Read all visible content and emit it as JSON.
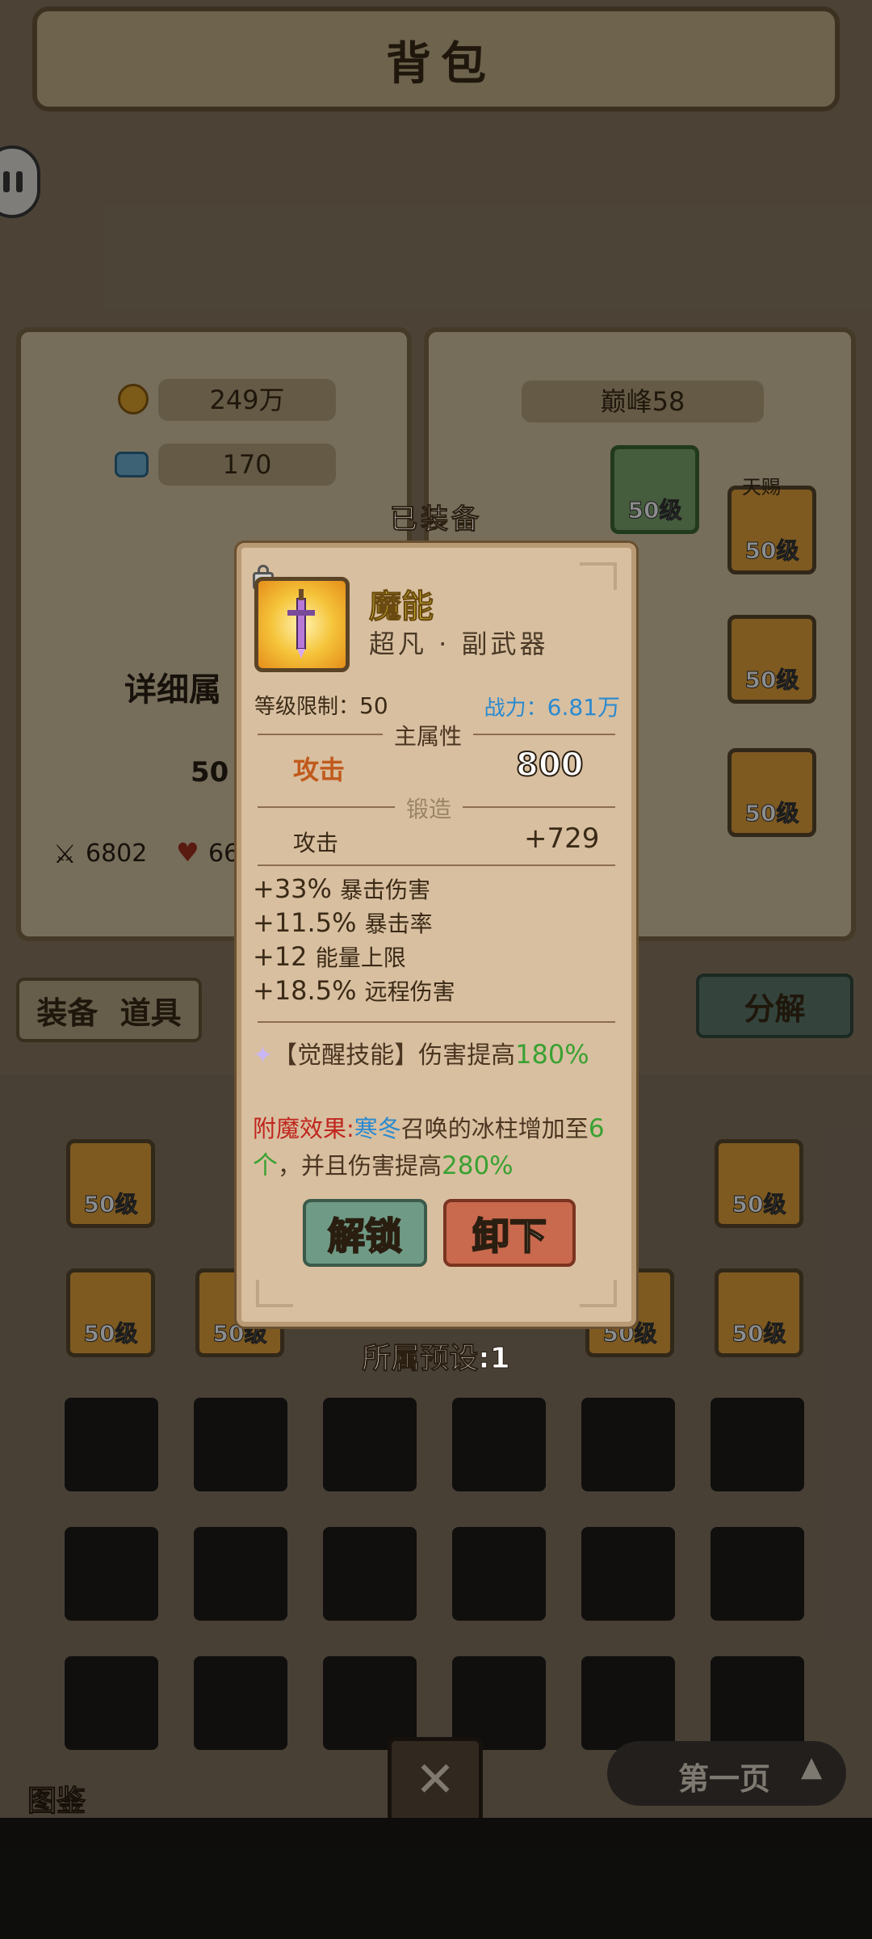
{
  "header": {
    "title": "背包"
  },
  "left_panel": {
    "gold": "249万",
    "gems": "170",
    "details_label": "详细属",
    "level_value": "50",
    "attack_value": "6802",
    "hp_value": "66"
  },
  "right_panel": {
    "rank_label": "巅峰58",
    "tianci_label": "天赐",
    "slot_level": "50级"
  },
  "tabs": {
    "equipment": "装备",
    "items": "道具",
    "decompose": "分解"
  },
  "inventory": {
    "slot_level": "50级"
  },
  "bottom": {
    "codex_label": "图鉴",
    "page_label": "第一页"
  },
  "modal": {
    "equipped_label": "已装备",
    "item_name": "魔能",
    "item_type": "超凡 · 副武器",
    "level_req_label": "等级限制：",
    "level_req_value": "50",
    "power_label": "战力：",
    "power_value": "6.81万",
    "main_attr_title": "主属性",
    "main_attr_name": "攻击",
    "main_attr_value": "800",
    "forge_title": "锻造",
    "forge_attr_name": "攻击",
    "forge_attr_value": "+729",
    "sub_attrs": [
      {
        "value": "+33%",
        "name": "暴击伤害"
      },
      {
        "value": "+11.5%",
        "name": "暴击率"
      },
      {
        "value": "+12",
        "name": "能量上限"
      },
      {
        "value": "+18.5%",
        "name": "远程伤害"
      }
    ],
    "awaken_skill_label": "【觉醒技能】",
    "awaken_skill_text": "伤害提高",
    "awaken_skill_value": "180%",
    "enchant_label": "附魔效果:",
    "enchant_skill": "寒冬",
    "enchant_text_1": "召唤的冰柱增加至",
    "enchant_count": "6个",
    "enchant_text_2": "，并且伤害提高",
    "enchant_value": "280%",
    "unlock_button": "解锁",
    "unequip_button": "卸下",
    "preset_label": "所属预设:1"
  },
  "colors": {
    "item_name": "#f3e23a",
    "power": "#2a8ad0",
    "skill_value": "#3aa132",
    "enchant_label": "#c0261e",
    "unlock_button": "#6f9a86",
    "unequip_button": "#c9694e"
  }
}
